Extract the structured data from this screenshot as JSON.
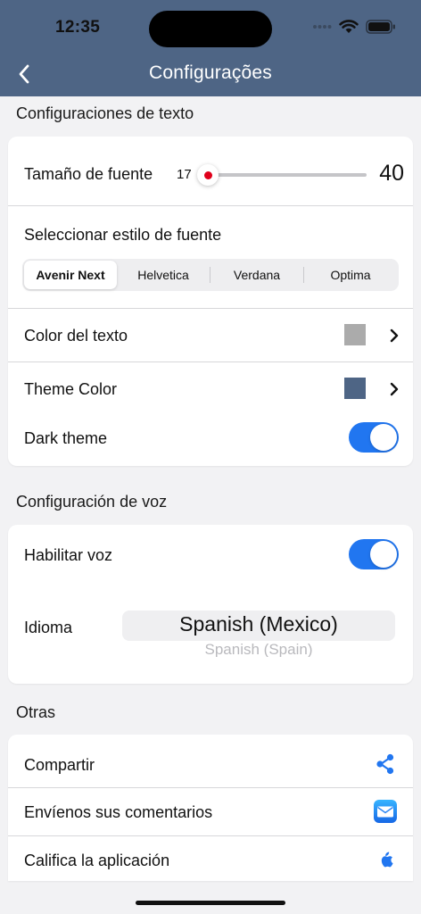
{
  "status_bar": {
    "time": "12:35"
  },
  "nav": {
    "title": "Configurações",
    "back_icon": "chevron-left-icon"
  },
  "colors": {
    "header": "#4e6585",
    "accent_blue": "#2176f0",
    "slider_red": "#e0001b",
    "text_color_swatch": "#ababab",
    "theme_color_swatch": "#4e6585"
  },
  "text_settings": {
    "header": "Configuraciones de texto",
    "font_size_label": "Tamaño de fuente",
    "slider_min": "17",
    "slider_max": "40",
    "slider_value_fraction": 0.0,
    "font_style_label": "Seleccionar estilo de fuente",
    "font_styles": [
      "Avenir Next",
      "Helvetica",
      "Verdana",
      "Optima"
    ],
    "selected_font_style": "Avenir Next",
    "text_color_label": "Color del texto",
    "theme_color_label": "Theme Color",
    "dark_theme_label": "Dark theme",
    "dark_theme_on": true
  },
  "voice_settings": {
    "header": "Configuración de voz",
    "enable_voice_label": "Habilitar voz",
    "enable_voice_on": true,
    "language_label": "Idioma",
    "language_selected": "Spanish (Mexico)",
    "language_next": "Spanish (Spain)"
  },
  "other": {
    "header": "Otras",
    "share_label": "Compartir",
    "feedback_label": "Envíenos sus comentarios",
    "rate_label": "Califica la aplicación"
  }
}
